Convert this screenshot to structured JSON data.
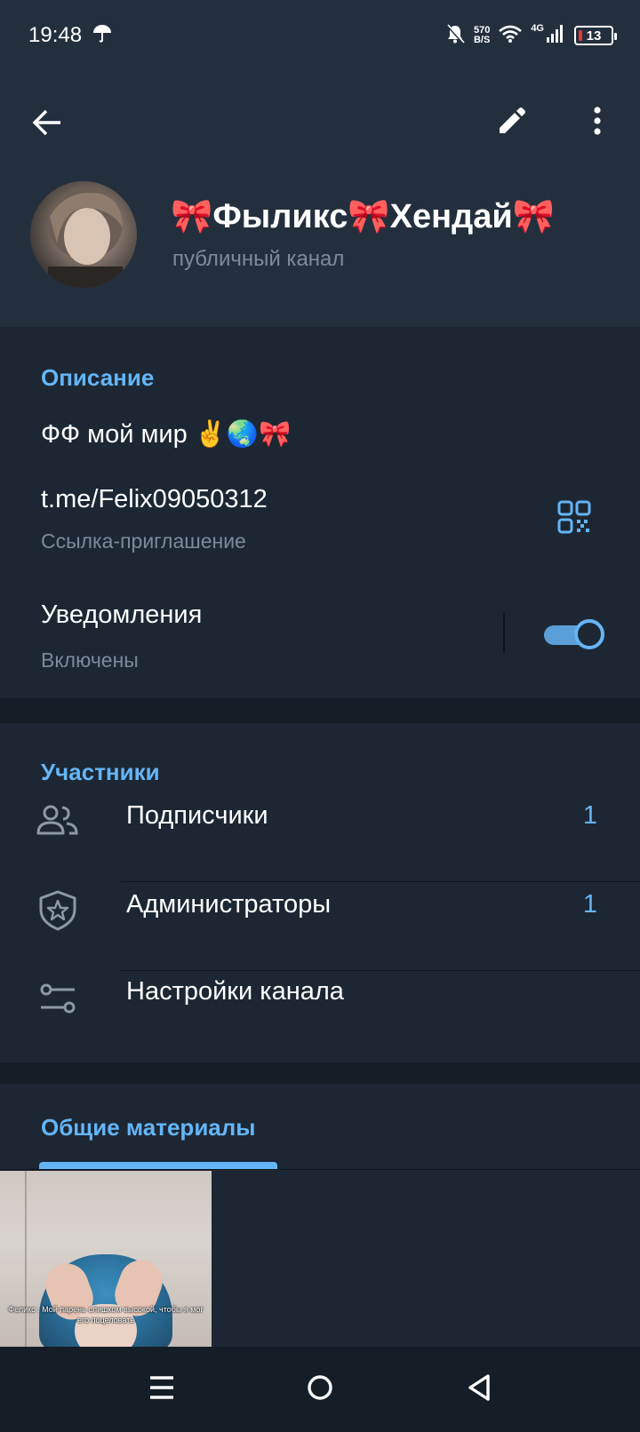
{
  "status_bar": {
    "time": "19:48",
    "net_speed_value": "570",
    "net_speed_unit": "B/S",
    "network_type": "4G",
    "battery": "13"
  },
  "header": {
    "title": "🎀Фыликс🎀Хендай🎀",
    "subtitle": "публичный канал"
  },
  "info": {
    "description_title": "Описание",
    "description_text": "ФФ мой мир ✌️🌏🎀",
    "link": "t.me/Felix09050312",
    "link_caption": "Ссылка-приглашение",
    "notifications_label": "Уведомления",
    "notifications_state": "Включены",
    "notifications_enabled": true
  },
  "members": {
    "title": "Участники",
    "items": [
      {
        "label": "Подписчики",
        "count": "1",
        "icon": "people-icon"
      },
      {
        "label": "Администраторы",
        "count": "1",
        "icon": "admin-shield-icon"
      },
      {
        "label": "Настройки канала",
        "count": "",
        "icon": "settings-sliders-icon"
      }
    ]
  },
  "shared_media": {
    "tab_label": "Общие материалы",
    "media_caption": "Феликс : Мой парень слишком высокой, чтобы я мог его поцеловать"
  },
  "colors": {
    "accent": "#64b5f6",
    "background": "#1d2733",
    "header_background": "#242f3e",
    "secondary_text": "#7c8b9c"
  }
}
